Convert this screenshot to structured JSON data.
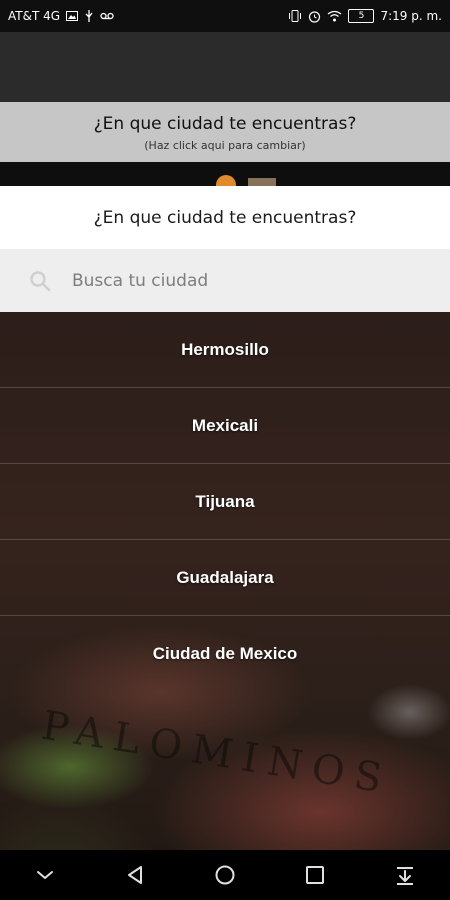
{
  "status_bar": {
    "carrier": "AT&T 4G",
    "left_icons": [
      "image-icon",
      "usb-icon",
      "voicemail-icon"
    ],
    "right_icons": [
      "vibrate-icon",
      "alarm-icon",
      "wifi-icon"
    ],
    "battery": "5",
    "time": "7:19 p. m."
  },
  "banner": {
    "title": "¿En que ciudad te encuentras?",
    "subtitle": "(Haz click aqui para cambiar)"
  },
  "modal": {
    "title": "¿En que ciudad te encuentras?",
    "search": {
      "placeholder": "Busca tu ciudad",
      "value": ""
    },
    "cities": [
      "Hermosillo",
      "Mexicali",
      "Tijuana",
      "Guadalajara",
      "Ciudad de Mexico"
    ]
  },
  "background": {
    "board_text": "PALOMINOS"
  },
  "nav_bar": {
    "buttons": [
      "chevron-down-icon",
      "back-icon",
      "home-icon",
      "recents-icon",
      "notification-pull-icon"
    ]
  }
}
